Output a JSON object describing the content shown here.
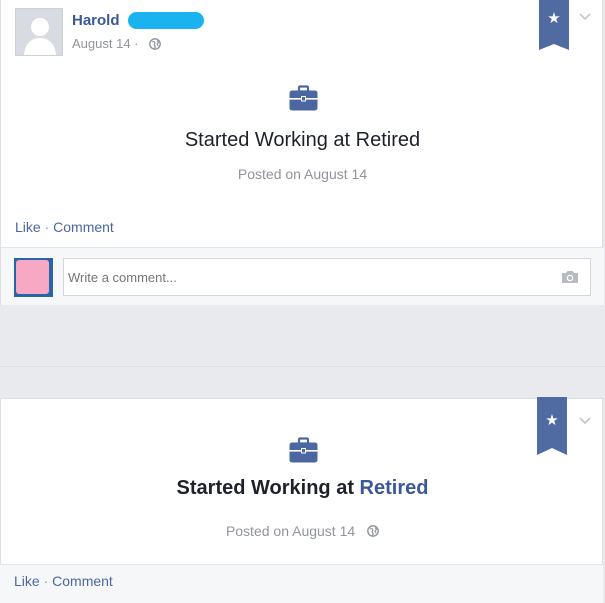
{
  "post1": {
    "author_name": "Harold",
    "date": "August 14 ·",
    "headline": "Started Working at Retired",
    "posted_on": "Posted on August 14",
    "actions": {
      "like": "Like",
      "separator": "·",
      "comment": "Comment"
    },
    "comment_placeholder": "Write a comment...",
    "ribbon_glyph": "★"
  },
  "post2": {
    "headline_prefix": "Started Working at ",
    "headline_link": "Retired",
    "posted_on": "Posted on August 14",
    "actions": {
      "like": "Like",
      "separator": "·",
      "comment": "Comment"
    },
    "ribbon_glyph": "★"
  },
  "colors": {
    "link_blue": "#3b5998",
    "ribbon_blue": "#4f6ba2",
    "briefcase_blue": "#4b67a1",
    "redaction_cyan": "#1ab3f0"
  }
}
